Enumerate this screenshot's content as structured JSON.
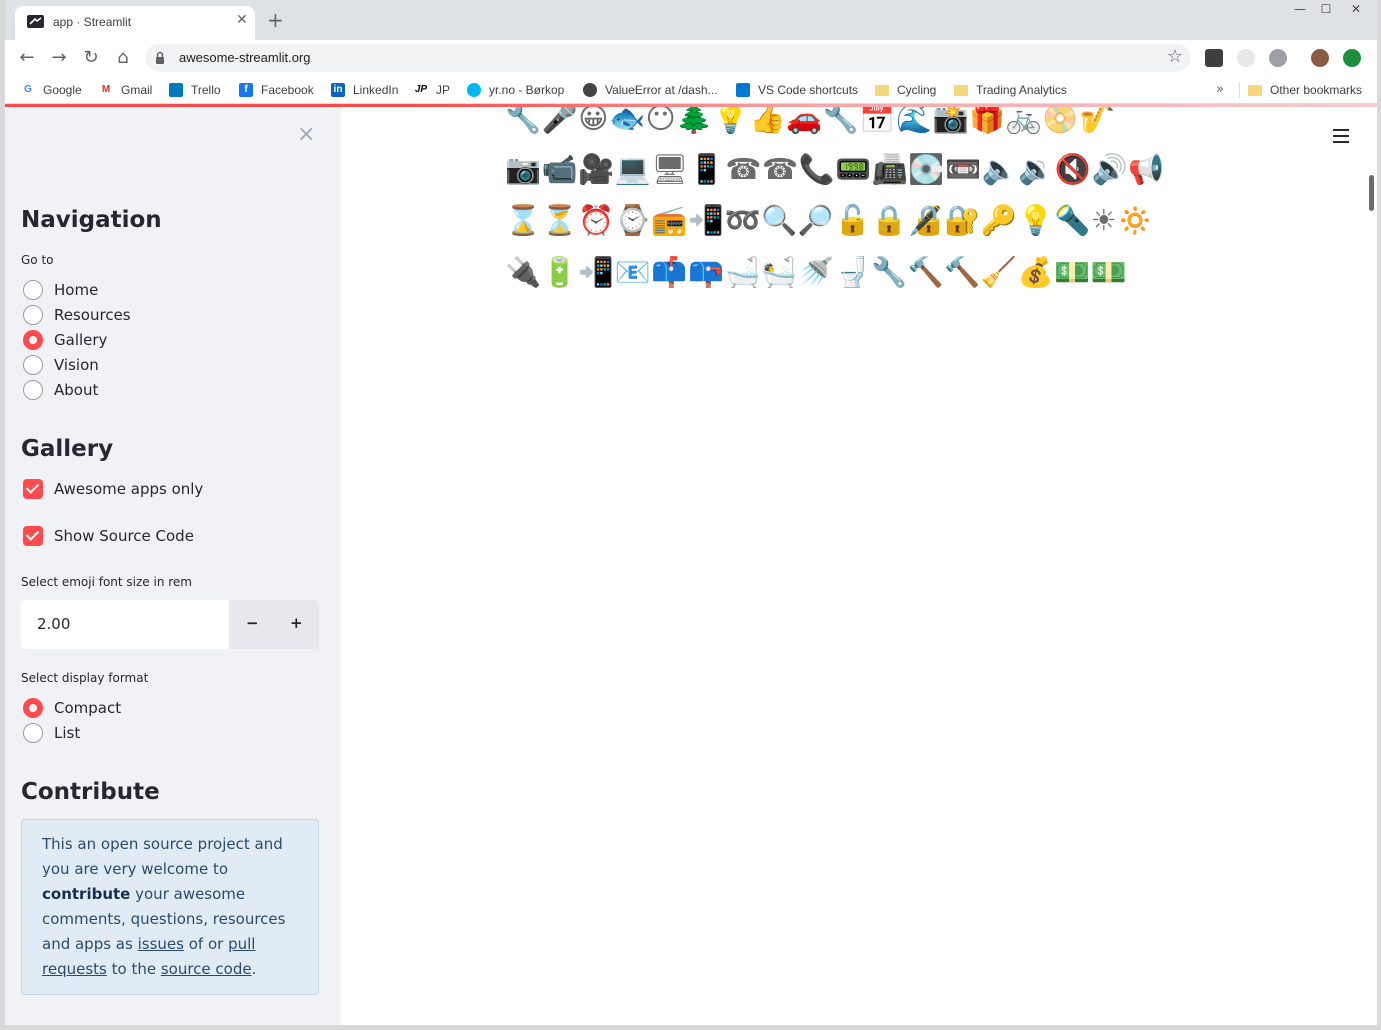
{
  "browser": {
    "tab_title": "app · Streamlit",
    "tab_close": "✕",
    "new_tab": "+",
    "window_min": "—",
    "window_max": "☐",
    "window_close": "✕",
    "url": "awesome-streamlit.org",
    "nav": {
      "back": "←",
      "forward": "→",
      "reload": "↻",
      "home": "⌂"
    },
    "bookmarks": [
      {
        "label": "Google",
        "icon": "google-icon",
        "color": "#4285f4"
      },
      {
        "label": "Gmail",
        "icon": "gmail-icon",
        "color": "#d93025"
      },
      {
        "label": "Trello",
        "icon": "trello-icon",
        "color": "#0079bf"
      },
      {
        "label": "Facebook",
        "icon": "facebook-icon",
        "color": "#1877f2"
      },
      {
        "label": "LinkedIn",
        "icon": "linkedin-icon",
        "color": "#0a66c2"
      },
      {
        "label": "JP",
        "icon": "jp-icon",
        "color": "#000000"
      },
      {
        "label": "yr.no - Børkop",
        "icon": "yr-icon",
        "color": "#00b8f1"
      },
      {
        "label": "ValueError at /dash...",
        "icon": "django-icon",
        "color": "#444444"
      },
      {
        "label": "VS Code shortcuts",
        "icon": "vscode-icon",
        "color": "#0078d4"
      },
      {
        "label": "Cycling",
        "icon": "folder-icon",
        "color": "#f5d67a"
      },
      {
        "label": "Trading Analytics",
        "icon": "folder-icon",
        "color": "#f5d67a"
      }
    ],
    "bookmarks_more": "»",
    "other_bookmarks": "Other bookmarks"
  },
  "sidebar": {
    "close": "×",
    "nav_heading": "Navigation",
    "goto_label": "Go to",
    "nav_options": [
      {
        "label": "Home",
        "selected": false
      },
      {
        "label": "Resources",
        "selected": false
      },
      {
        "label": "Gallery",
        "selected": true
      },
      {
        "label": "Vision",
        "selected": false
      },
      {
        "label": "About",
        "selected": false
      }
    ],
    "gallery_heading": "Gallery",
    "awesome_only_label": "Awesome apps only",
    "awesome_only_checked": true,
    "show_source_label": "Show Source Code",
    "show_source_checked": true,
    "font_size_label": "Select emoji font size in rem",
    "font_size_value": "2.00",
    "minus": "−",
    "plus": "+",
    "format_label": "Select display format",
    "format_options": [
      {
        "label": "Compact",
        "selected": true
      },
      {
        "label": "List",
        "selected": false
      }
    ],
    "contribute_heading": "Contribute",
    "contribute": {
      "t1": "This an open source project and you are very welcome to ",
      "b1": "contribute",
      "t2": " your awesome comments, questions, resources and apps as ",
      "l1": "issues",
      "t3": " of or ",
      "l2": "pull requests",
      "t4": " to the ",
      "l3": "source code",
      "t5": "."
    }
  },
  "main": {
    "accent": "#ff4b4b",
    "emoji_rows": [
      "🔧🎤😀🐟😶🌲💡👍🚗🔧📅🌊📸🎁🚲📀🎷",
      "📷📹🎥💻🖥📱☎☎📞📟📠💽📼🔈🔉🔇🔊📢",
      "⌛⏳⏰⌚📻📲➿🔍🔎🔓🔒🔏🔐🔑💡🔦☀🔅",
      "🔌🔋📲📧📫📪🛁🛀🚿🚽🔧🔨🔨🧹💰💵💵",
      "",
      "",
      "",
      "",
      "",
      "",
      "",
      "",
      "",
      "",
      "",
      "",
      "",
      ""
    ]
  }
}
